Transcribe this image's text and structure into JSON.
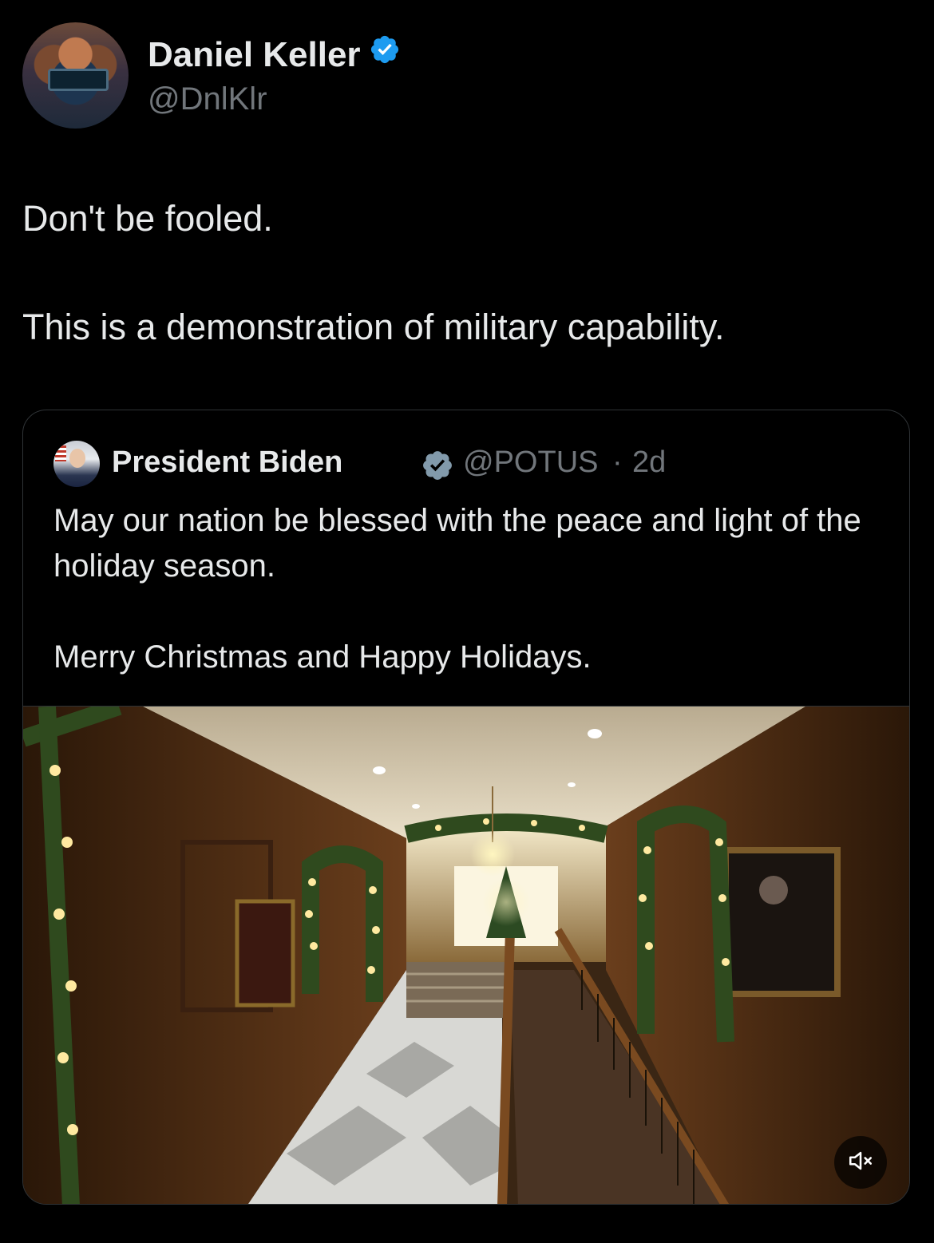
{
  "author": {
    "name": "Daniel Keller",
    "handle": "@DnlKlr",
    "verified": true
  },
  "tweet": {
    "lines": [
      "Don't be fooled.",
      "This is a demonstration of military capability."
    ]
  },
  "quoted_tweet": {
    "name": "President Biden",
    "handle": "@POTUS",
    "separator": "·",
    "time": "2d",
    "verified": true,
    "paragraphs": [
      "May our nation be blessed with the peace and light of the holiday season.",
      "Merry Christmas and Happy Holidays."
    ],
    "media": {
      "type": "video",
      "muted": true,
      "subject": "White House hallway decorated with lit garlands and Christmas trees"
    }
  },
  "colors": {
    "background": "#000000",
    "text": "#e7e9ea",
    "secondary": "#71767b",
    "border": "#2f3336",
    "verified_badge": "#1d9bf0",
    "verified_badge_gray": "#829aab"
  }
}
